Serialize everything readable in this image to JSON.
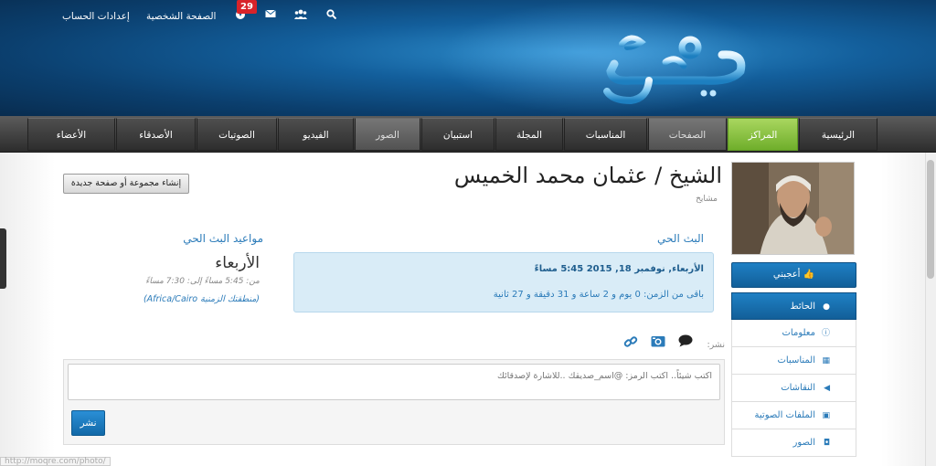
{
  "topbar": {
    "settings": "إعدادات الحساب",
    "profile": "الصفحة الشخصية",
    "notifications_count": "29",
    "icons": [
      "notifications-icon",
      "mail-icon",
      "friends-icon",
      "search-icon"
    ]
  },
  "nav": {
    "items": [
      "الرئيسية",
      "المراكز",
      "الصفحات",
      "المناسبات",
      "المجلة",
      "استبيان",
      "الصور",
      "الفيديو",
      "الصوتيات",
      "الأصدقاء",
      "الأعضاء"
    ]
  },
  "page": {
    "title": "الشيخ / عثمان محمد الخميس",
    "category": "مشايخ",
    "create_button": "إنشاء مجموعة أو صفحة جديدة"
  },
  "live": {
    "heading": "البث الحي",
    "date_line": "الأربعاء, نوفمبر 18, 2015 5:45 مساءً",
    "remaining": "باقى من الزمن: 0 يوم و 2 ساعة و 31 دقيقة و 27 ثانية"
  },
  "schedule": {
    "heading": "مواعيد البث الحي",
    "day": "الأربعاء",
    "time": "من: 5:45 مساءً إلى: 7:30 مساءً",
    "timezone": "(منطقتك الزمنية Africa/Cairo)"
  },
  "post": {
    "label": "نشر:",
    "placeholder": "اكتب شيئاً.. اكتب الرمز: @اسم_صديقك ..للاشارة لإصدقائك",
    "submit": "نشر"
  },
  "sidebar": {
    "like": "أعجبني",
    "items": [
      "الحائط",
      "معلومات",
      "المناسبات",
      "النقاشات",
      "الملفات الصوتية",
      "الصور"
    ]
  },
  "status_url": "http://moqre.com/photo/",
  "colors": {
    "brand_blue": "#1f80c4",
    "nav_active_green": "#7bb932",
    "badge_red": "#d8232a"
  }
}
